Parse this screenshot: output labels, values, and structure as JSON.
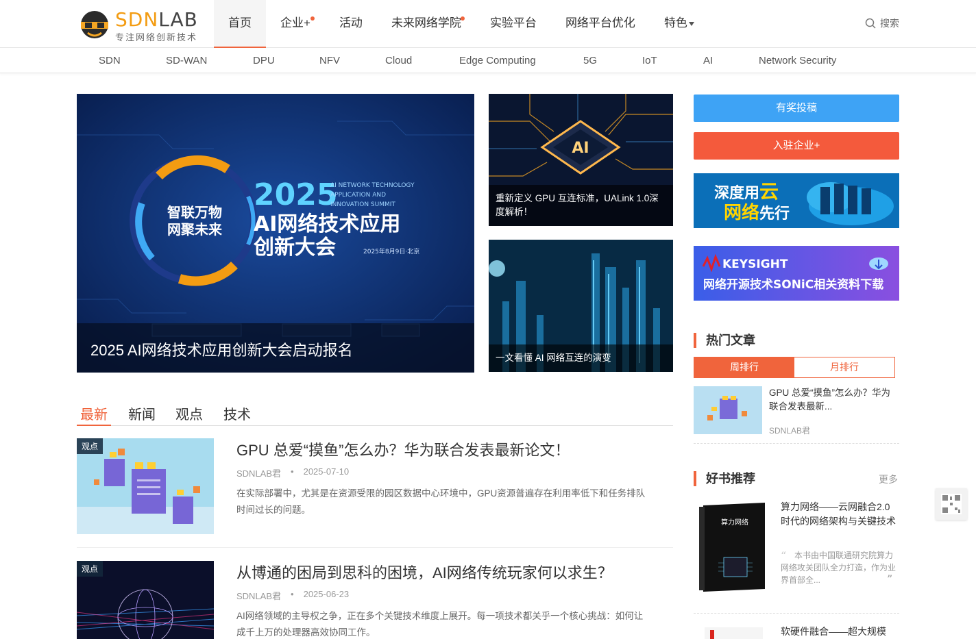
{
  "logo": {
    "brand_a": "SDN",
    "brand_b": "LAB",
    "slogan": "专注网络创新技术"
  },
  "nav": {
    "items": [
      {
        "label": "首页",
        "active": true,
        "dot": false
      },
      {
        "label": "企业+",
        "active": false,
        "dot": true
      },
      {
        "label": "活动",
        "active": false,
        "dot": false
      },
      {
        "label": "未来网络学院",
        "active": false,
        "dot": true
      },
      {
        "label": "实验平台",
        "active": false,
        "dot": false
      },
      {
        "label": "网络平台优化",
        "active": false,
        "dot": false
      },
      {
        "label": "特色",
        "active": false,
        "dot": false,
        "caret": true
      }
    ],
    "search_label": "搜索"
  },
  "subnav": [
    "SDN",
    "SD-WAN",
    "DPU",
    "NFV",
    "Cloud",
    "Edge Computing",
    "5G",
    "IoT",
    "AI",
    "Network Security"
  ],
  "hero": {
    "caption": "2025 AI网络技术应用创新大会启动报名",
    "poster_year": "2025",
    "poster_en": [
      "AI NETWORK TECHNOLOGY",
      "APPLICATION AND",
      "INNOVATION SUMMIT"
    ],
    "poster_title_1": "AI网络技术应用",
    "poster_title_2": "创新大会",
    "poster_slogan_1": "智联万物",
    "poster_slogan_2": "网聚未来",
    "poster_date": "2025年8月9日·北京",
    "poster_chip": "AI"
  },
  "side_articles": [
    {
      "caption": "重新定义 GPU 互连标准，UALink 1.0深度解析！"
    },
    {
      "caption": "一文看懂 AI 网络互连的演变"
    }
  ],
  "sidebar": {
    "btn_contribute": "有奖投稿",
    "btn_join": "入驻企业+",
    "ad1": {
      "text_a": "深度用",
      "text_b": "云",
      "text_c": "网络",
      "text_d": "先行"
    },
    "ad2": {
      "brand": "KEYSIGHT",
      "text": "网络开源技术SONiC相关资料下载"
    },
    "hot_title": "热门文章",
    "hot_tabs": [
      "周排行",
      "月排行"
    ],
    "hot_item": {
      "title": "GPU 总爱“摸鱼”怎么办？华为联合发表最新...",
      "author": "SDNLAB君"
    },
    "books_title": "好书推荐",
    "books_more": "更多",
    "book1": {
      "title": "算力网络——云网融合2.0时代的网络架构与关键技术",
      "desc": "本书由中国联通研究院算力网络攻关团队全力打造，作为业界首部全...",
      "cover_title": "算力网络"
    },
    "book2": {
      "title": "软硬件融合——超大规模"
    }
  },
  "news_tabs": [
    "最新",
    "新闻",
    "观点",
    "技术"
  ],
  "articles": [
    {
      "tag": "观点",
      "title": "GPU 总爱“摸鱼”怎么办？华为联合发表最新论文！",
      "author": "SDNLAB君",
      "date": "2025-07-10",
      "summary": "在实际部署中，尤其是在资源受限的园区数据中心环境中，GPU资源普遍存在利用率低下和任务排队时间过长的问题。"
    },
    {
      "tag": "观点",
      "title": "从博通的困局到思科的困境，AI网络传统玩家何以求生？",
      "author": "SDNLAB君",
      "date": "2025-06-23",
      "summary": "AI网络领域的主导权之争，正在多个关键技术维度上展开。每一项技术都关乎一个核心挑战：如何让成千上万的处理器高效协同工作。"
    }
  ],
  "colors": {
    "accent": "#f0643c",
    "blue_button": "#3ea3f5",
    "orange_button": "#f0643c"
  }
}
